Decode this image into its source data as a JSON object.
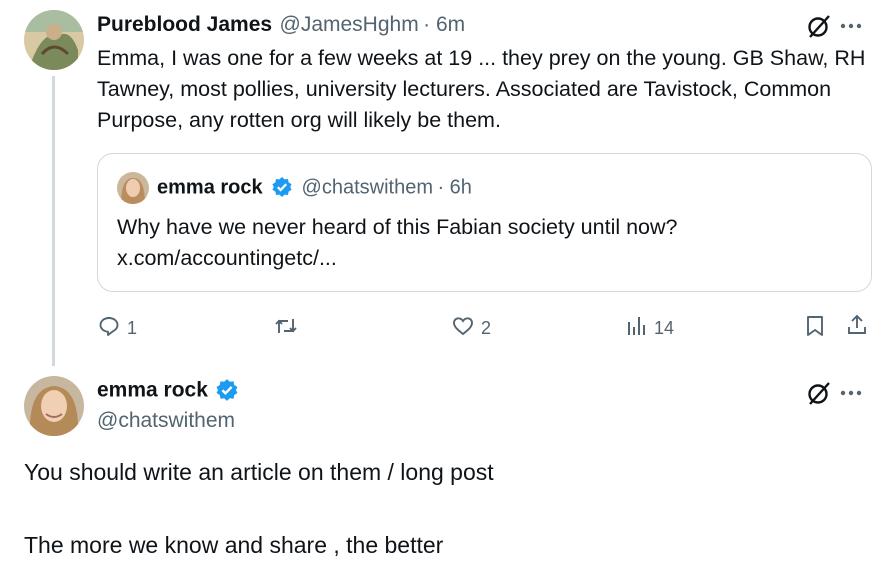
{
  "tweet": {
    "author_name": "Pureblood James",
    "author_handle": "@JamesHghm",
    "time": "· 6m",
    "text": "Emma, I was one for a few weeks at 19 ... they prey on the young.  GB Shaw, RH Tawney, most pollies, university lecturers. Associated are Tavistock, Common Purpose, any rotten org will likely be them.",
    "quote": {
      "author_name": "emma rock",
      "author_handle": "@chatswithem",
      "time": "· 6h",
      "text": "Why have we never heard of this Fabian society until now?",
      "link": "x.com/accountingetc/..."
    },
    "actions": {
      "replies": "1",
      "likes": "2",
      "views": "14"
    }
  },
  "reply": {
    "author_name": "emma rock",
    "author_handle": "@chatswithem",
    "line1": "You should write an article on them / long post",
    "line2": "The more we know and share , the better"
  },
  "colors": {
    "verified": "#1d9bf0",
    "muted": "#536471",
    "border": "#cfd9de"
  },
  "icons": [
    "grok-icon",
    "more-icon",
    "verified-badge-icon",
    "reply-icon",
    "retweet-icon",
    "like-icon",
    "views-icon",
    "bookmark-icon",
    "share-icon"
  ]
}
